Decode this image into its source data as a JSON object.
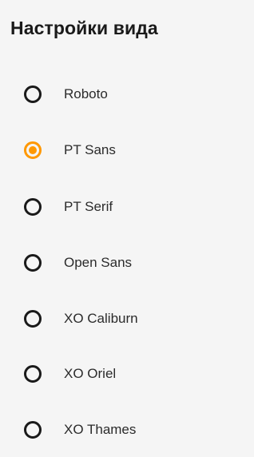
{
  "settings": {
    "title": "Настройки вида",
    "accent_color": "#ff9800",
    "selected": "PT Sans",
    "options": [
      {
        "label": "Roboto",
        "checked": false
      },
      {
        "label": "PT Sans",
        "checked": true
      },
      {
        "label": "PT Serif",
        "checked": false
      },
      {
        "label": "Open Sans",
        "checked": false
      },
      {
        "label": "XO Caliburn",
        "checked": false
      },
      {
        "label": "XO Oriel",
        "checked": false
      },
      {
        "label": "XO Thames",
        "checked": false
      }
    ]
  }
}
